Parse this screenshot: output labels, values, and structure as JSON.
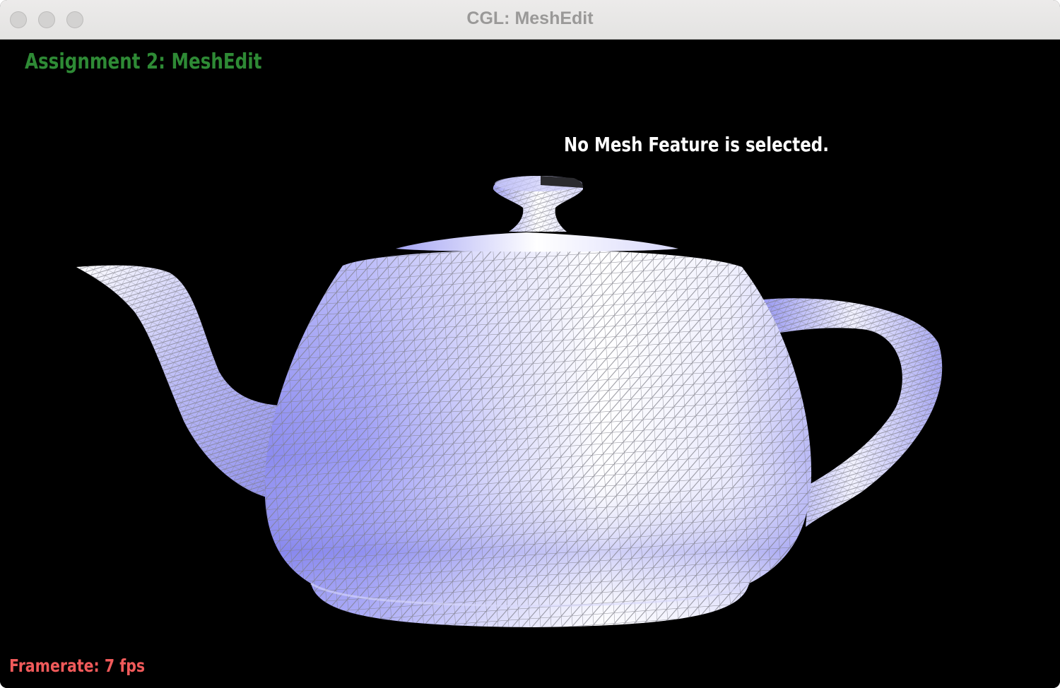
{
  "window": {
    "title": "CGL: MeshEdit",
    "controls": [
      "close-button",
      "minimize-button",
      "zoom-button"
    ]
  },
  "hud": {
    "title": "Assignment 2: MeshEdit",
    "message": "No Mesh Feature is selected.",
    "framerate": "Framerate: 7 fps"
  },
  "scene": {
    "model": "teapot",
    "render_mode": "shaded with wireframe",
    "colors": {
      "background": "#000000",
      "mesh_base": "#8f8ff0",
      "mesh_highlight": "#ffffff",
      "wireframe": "#8a8a8a",
      "title_text": "#2e8a35",
      "message_text": "#ffffff",
      "framerate_text": "#f05a5a"
    }
  }
}
